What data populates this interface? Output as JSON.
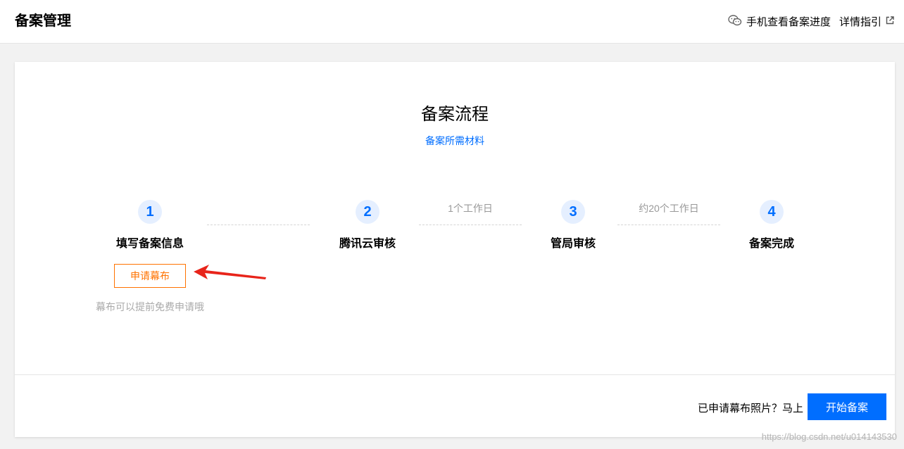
{
  "header": {
    "title": "备案管理",
    "mobile_progress_label": "手机查看备案进度",
    "guide_label": "详情指引",
    "mobile_icon": "wechat-icon",
    "guide_icon": "external-link-icon"
  },
  "flow": {
    "title": "备案流程",
    "materials_link": "备案所需材料",
    "steps": [
      {
        "number": "1",
        "label": "填写备案信息"
      },
      {
        "number": "2",
        "label": "腾讯云审核"
      },
      {
        "number": "3",
        "label": "管局审核"
      },
      {
        "number": "4",
        "label": "备案完成"
      }
    ],
    "durations": [
      "1个工作日",
      "约20个工作日"
    ],
    "apply_curtain_label": "申请幕布",
    "curtain_hint": "幕布可以提前免费申请哦"
  },
  "footer": {
    "prompt": "已申请幕布照片？马上",
    "start_label": "开始备案"
  },
  "watermark": "https://blog.csdn.net/u014143530",
  "colors": {
    "accent": "#006eff",
    "warning": "#ff7200",
    "annotation_arrow": "#e8241a",
    "step_circle_bg": "#e5efff"
  }
}
